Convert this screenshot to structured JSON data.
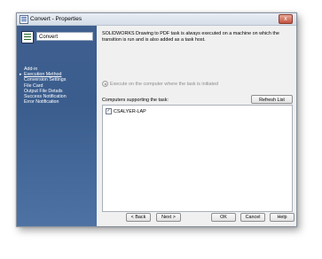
{
  "window": {
    "title": "Convert - Properties",
    "close_glyph": "x"
  },
  "sidebar": {
    "task_name_value": "Convert",
    "items": [
      {
        "label": "Add-in"
      },
      {
        "label": "Execution Method",
        "active": true
      },
      {
        "label": "Conversion Settings"
      },
      {
        "label": "File Card"
      },
      {
        "label": "Output File Details"
      },
      {
        "label": "Success Notification"
      },
      {
        "label": "Error Notification"
      }
    ]
  },
  "main": {
    "description": "SOLIDWORKS Drawing to PDF task is always executed on a machine on which the transition is run and is also added as a task host.",
    "execute_option_label": "Execute on the computer where the task is initiated",
    "computers_label": "Computers supporting the task:",
    "refresh_label": "Refresh List",
    "computers": [
      {
        "name": "CSALYER-LAP",
        "checked": true
      }
    ]
  },
  "footer": {
    "back_label": "< Back",
    "next_label": "Next >",
    "ok_label": "OK",
    "cancel_label": "Cancel",
    "help_label": "Help"
  },
  "colors": {
    "sidebar_top": "#3f5f8f",
    "sidebar_bottom": "#4d72a3",
    "dialog_bg": "#f0f0f0"
  },
  "icons": {
    "app": "properties-icon",
    "task": "task-checklist-icon",
    "close": "close-icon"
  }
}
